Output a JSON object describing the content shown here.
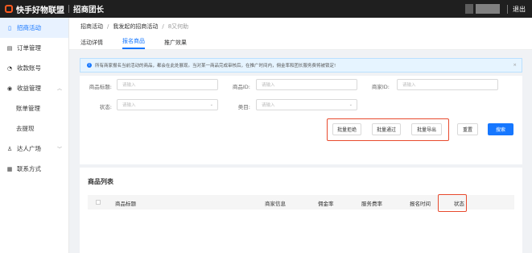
{
  "app": {
    "brand": "快手好物联盟",
    "subtitle": "招商团长",
    "logout": "退出"
  },
  "sidebar": {
    "items": [
      {
        "label": "招商活动",
        "icon": "doc-icon",
        "active": true
      },
      {
        "label": "订单管理",
        "icon": "order-icon"
      },
      {
        "label": "收款账号",
        "icon": "wallet-icon"
      },
      {
        "label": "收益管理",
        "icon": "income-icon",
        "caret": true
      },
      {
        "label": "账单管理",
        "child": true
      },
      {
        "label": "去提现",
        "child": true
      },
      {
        "label": "达人广场",
        "icon": "user-icon",
        "caret": true
      },
      {
        "label": "联系方式",
        "icon": "grid-icon"
      }
    ]
  },
  "breadcrumb": {
    "items": [
      "招商活动",
      "我发起的招商活动"
    ],
    "current": "8又何助"
  },
  "tabs": [
    "活动详情",
    "报名商品",
    "推广效果"
  ],
  "alert": {
    "text": "所有商家报名当前活动的商品，都会在此处展现。当对某一商品完成审核后，在推广时间内，佣金率和团长服务费将被锁定!"
  },
  "filters": {
    "title_label": "商品标题:",
    "title_placeholder": "请输入",
    "id_label": "商品ID:",
    "id_placeholder": "请输入",
    "merchant_label": "商家ID:",
    "merchant_placeholder": "请输入",
    "status_label": "状态:",
    "status_placeholder": "请输入",
    "category_label": "类目:",
    "category_placeholder": "请输入"
  },
  "actions": {
    "reject": "批量拒绝",
    "approve": "批量通过",
    "export": "批量导出",
    "reset": "重置",
    "search": "搜索"
  },
  "list": {
    "title": "商品列表",
    "columns": [
      "商品标题",
      "商家信息",
      "佣金率",
      "服务费率",
      "报名时间",
      "状态"
    ]
  },
  "colors": {
    "accent": "#1677ff",
    "highlight": "#e84a2e",
    "topbar": "#1f1f1f"
  }
}
